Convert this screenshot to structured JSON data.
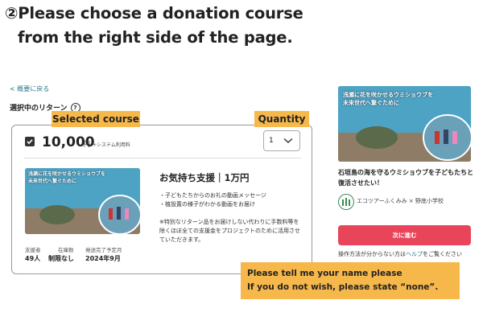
{
  "instruction": {
    "line1": "②Please choose a donation course",
    "line2": "from the right side of the page."
  },
  "nav": {
    "back_link": "< 概要に戻る"
  },
  "selection": {
    "title": "選択中のリターン",
    "help_symbol": "?"
  },
  "annotations": {
    "selected_course": "Selected course",
    "quantity": "Quantity",
    "notice_line1": "Please tell me your name please",
    "notice_line2": "If you do not wish, please state “none”."
  },
  "course": {
    "checked": true,
    "price": "10,000",
    "price_unit": "円",
    "price_note": "+システム利用料",
    "quantity": "1",
    "reward_title": "お気持ち支援｜1万円",
    "reward_items": [
      "・子どもたちからのお礼の動画メッセージ",
      "・植設置の様子がわかる動画をお届け"
    ],
    "reward_note": "※特別なリターン品をお届けしない代わりに手数料等を除くほぼ全ての支援金をプロジェクトのために活用させていただきます。",
    "thumb_caption_line1": "浅瀬に花を咲かせるウミショウブを",
    "thumb_caption_line2": "未来世代へ繋ぐために",
    "stats": [
      {
        "label": "支援者",
        "value": "49人"
      },
      {
        "label": "在庫数",
        "value": "制限なし"
      },
      {
        "label": "発送完了予定月",
        "value": "2024年9月"
      }
    ]
  },
  "project": {
    "title": "石垣島の海を守るウミショウブを子どもたちと復活させたい！",
    "org": "エコツアーふくみみ × 野底小学校",
    "next_button": "次に進む",
    "help_prefix": "操作方法が分からない方は",
    "help_link": "ヘルプ",
    "help_suffix": "をご覧ください"
  },
  "colors": {
    "accent_red": "#e8445a",
    "tag_orange": "#f7b84b",
    "link_teal": "#2a7a8c"
  },
  "icons": [
    "help-icon",
    "check-icon",
    "chevron-down-icon",
    "org-logo-icon"
  ]
}
